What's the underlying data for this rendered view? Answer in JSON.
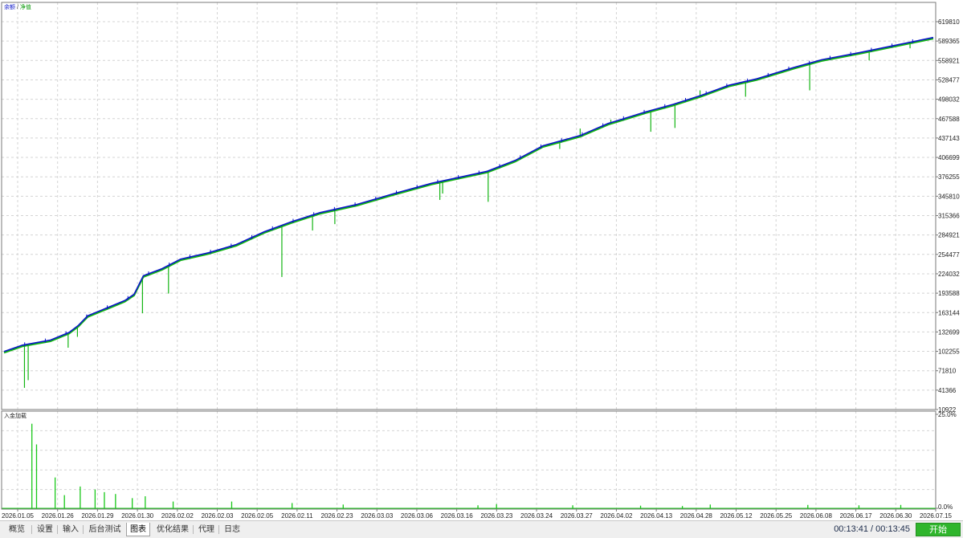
{
  "legend": {
    "balance": "余额",
    "separator": "/",
    "equity": "净值"
  },
  "sub_legend": "入金加载",
  "tabs": [
    {
      "label": "概览",
      "active": false
    },
    {
      "label": "设置",
      "active": false
    },
    {
      "label": "输入",
      "active": false
    },
    {
      "label": "后台测试",
      "active": false
    },
    {
      "label": "图表",
      "active": true
    },
    {
      "label": "优化结果",
      "active": false
    },
    {
      "label": "代理",
      "active": false
    },
    {
      "label": "日志",
      "active": false
    }
  ],
  "timer": "00:13:41 / 00:13:45",
  "start_button": "开始",
  "colors": {
    "balance": "#0a14c8",
    "equity": "#13b513",
    "deposit_load": "#18c818",
    "grid": "#cfcfcf",
    "start_button": "#2fb52c"
  },
  "chart_data": [
    {
      "type": "line",
      "title": "",
      "y_ticks": [
        "619810",
        "589365",
        "558921",
        "528477",
        "498032",
        "467588",
        "437143",
        "406699",
        "376255",
        "345810",
        "315366",
        "284921",
        "254477",
        "224032",
        "193588",
        "163144",
        "132699",
        "102255",
        "71810",
        "41366",
        "10922"
      ],
      "ylim": [
        10922,
        619810
      ],
      "x_ticks": [
        "2026.01.05",
        "2026.01.26",
        "2026.01.29",
        "2026.01.30",
        "2026.02.02",
        "2026.02.03",
        "2026.02.05",
        "2026.02.11",
        "2026.02.23",
        "2026.03.03",
        "2026.03.06",
        "2026.03.16",
        "2026.03.23",
        "2026.03.24",
        "2026.03.27",
        "2026.04.02",
        "2026.04.13",
        "2026.04.28",
        "2026.05.12",
        "2026.05.25",
        "2026.06.08",
        "2026.06.17",
        "2026.06.30",
        "2026.07.15"
      ],
      "grid": true,
      "legend_position": "top-left",
      "series": [
        {
          "name": "余额",
          "points": [
            [
              0,
              102000
            ],
            [
              0.02,
              112000
            ],
            [
              0.05,
              120000
            ],
            [
              0.07,
              132000
            ],
            [
              0.08,
              143000
            ],
            [
              0.09,
              158000
            ],
            [
              0.11,
              170000
            ],
            [
              0.13,
              182000
            ],
            [
              0.14,
              192000
            ],
            [
              0.15,
              221000
            ],
            [
              0.17,
              232000
            ],
            [
              0.19,
              247000
            ],
            [
              0.22,
              257000
            ],
            [
              0.25,
              270000
            ],
            [
              0.28,
              290000
            ],
            [
              0.31,
              306000
            ],
            [
              0.34,
              320000
            ],
            [
              0.38,
              333000
            ],
            [
              0.42,
              350000
            ],
            [
              0.46,
              366000
            ],
            [
              0.52,
              385000
            ],
            [
              0.55,
              402000
            ],
            [
              0.58,
              425000
            ],
            [
              0.62,
              441000
            ],
            [
              0.65,
              460000
            ],
            [
              0.69,
              478000
            ],
            [
              0.72,
              490000
            ],
            [
              0.75,
              504000
            ],
            [
              0.78,
              520000
            ],
            [
              0.81,
              530000
            ],
            [
              0.85,
              548000
            ],
            [
              0.88,
              560000
            ],
            [
              0.92,
              571000
            ],
            [
              0.96,
              583000
            ],
            [
              1.0,
              595000
            ]
          ]
        },
        {
          "name": "净值",
          "spikes": [
            [
              0.022,
              45000
            ],
            [
              0.026,
              57000
            ],
            [
              0.069,
              108000
            ],
            [
              0.079,
              125000
            ],
            [
              0.149,
              162000
            ],
            [
              0.177,
              193000
            ],
            [
              0.299,
              219000
            ],
            [
              0.332,
              292000
            ],
            [
              0.356,
              302000
            ],
            [
              0.444,
              357000
            ],
            [
              0.469,
              340000
            ],
            [
              0.472,
              350000
            ],
            [
              0.521,
              337000
            ],
            [
              0.598,
              420000
            ],
            [
              0.62,
              452000
            ],
            [
              0.653,
              466000
            ],
            [
              0.696,
              447000
            ],
            [
              0.722,
              453000
            ],
            [
              0.749,
              512000
            ],
            [
              0.798,
              502000
            ],
            [
              0.867,
              512000
            ],
            [
              0.931,
              559000
            ],
            [
              0.975,
              578000
            ]
          ]
        }
      ]
    },
    {
      "type": "bar",
      "title": "入金加载",
      "y_ticks": [
        "25.0%",
        "0.0%"
      ],
      "ylim": [
        0,
        25
      ],
      "values": [
        [
          0.03,
          22.5
        ],
        [
          0.035,
          17.0
        ],
        [
          0.055,
          8.2
        ],
        [
          0.065,
          3.5
        ],
        [
          0.082,
          5.8
        ],
        [
          0.098,
          5.0
        ],
        [
          0.108,
          4.3
        ],
        [
          0.12,
          3.8
        ],
        [
          0.138,
          2.7
        ],
        [
          0.152,
          3.2
        ],
        [
          0.182,
          1.8
        ],
        [
          0.245,
          1.8
        ],
        [
          0.31,
          1.4
        ],
        [
          0.365,
          1.0
        ],
        [
          0.51,
          0.8
        ],
        [
          0.53,
          1.1
        ],
        [
          0.612,
          0.8
        ],
        [
          0.685,
          0.7
        ],
        [
          0.73,
          0.6
        ],
        [
          0.76,
          1.0
        ],
        [
          0.865,
          0.9
        ],
        [
          0.92,
          0.8
        ],
        [
          0.965,
          0.9
        ]
      ]
    }
  ]
}
